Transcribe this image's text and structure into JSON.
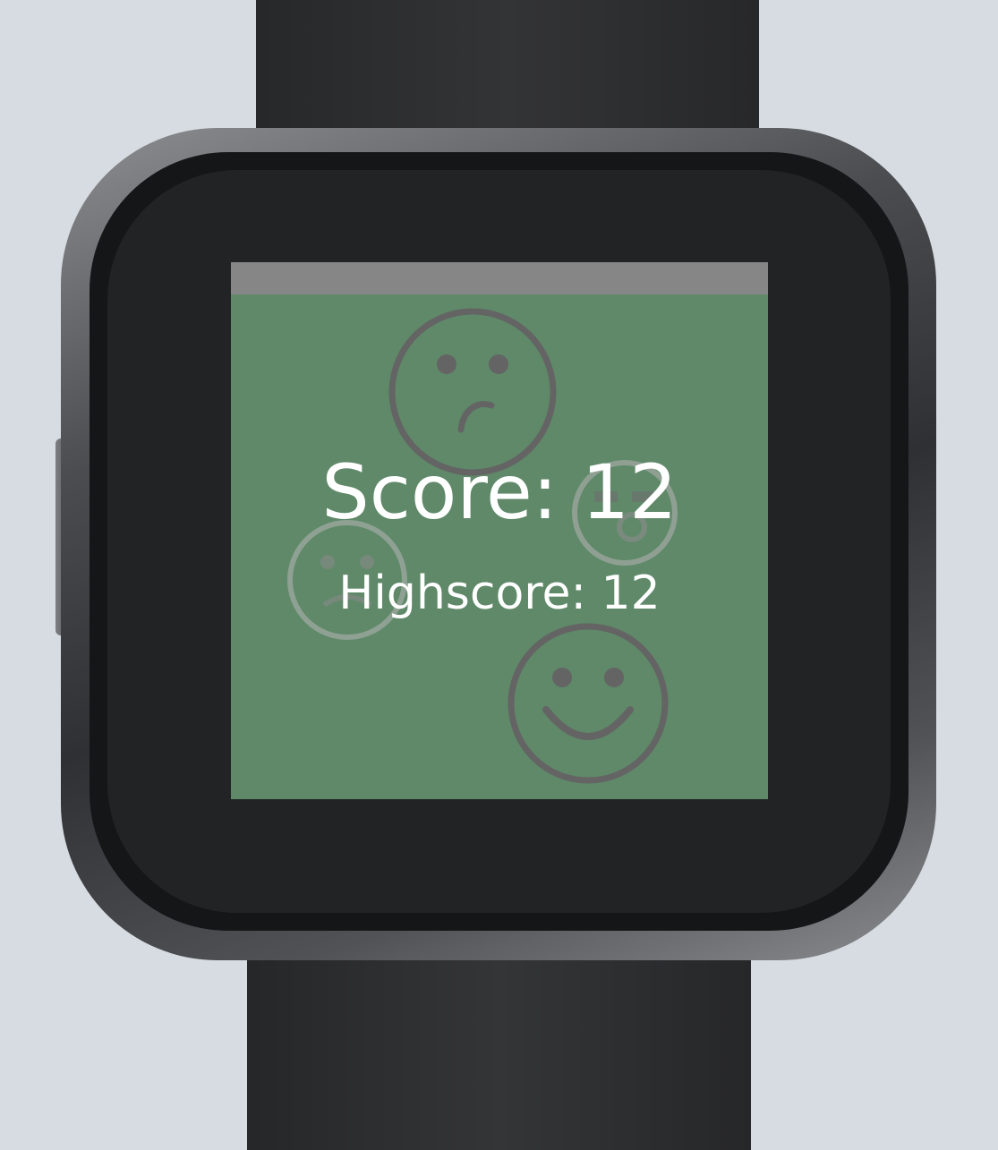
{
  "game": {
    "score_label": "Score: 12",
    "highscore_label": "Highscore: 12"
  },
  "colors": {
    "background": "#d6dce1",
    "screen": "#5f8969",
    "status_bar": "#868686",
    "text": "#ffffff",
    "smiley_stroke": "#646464"
  },
  "smileys": [
    "sad-face-icon",
    "neutral-face-icon",
    "winking-face-icon",
    "smiling-face-icon"
  ]
}
